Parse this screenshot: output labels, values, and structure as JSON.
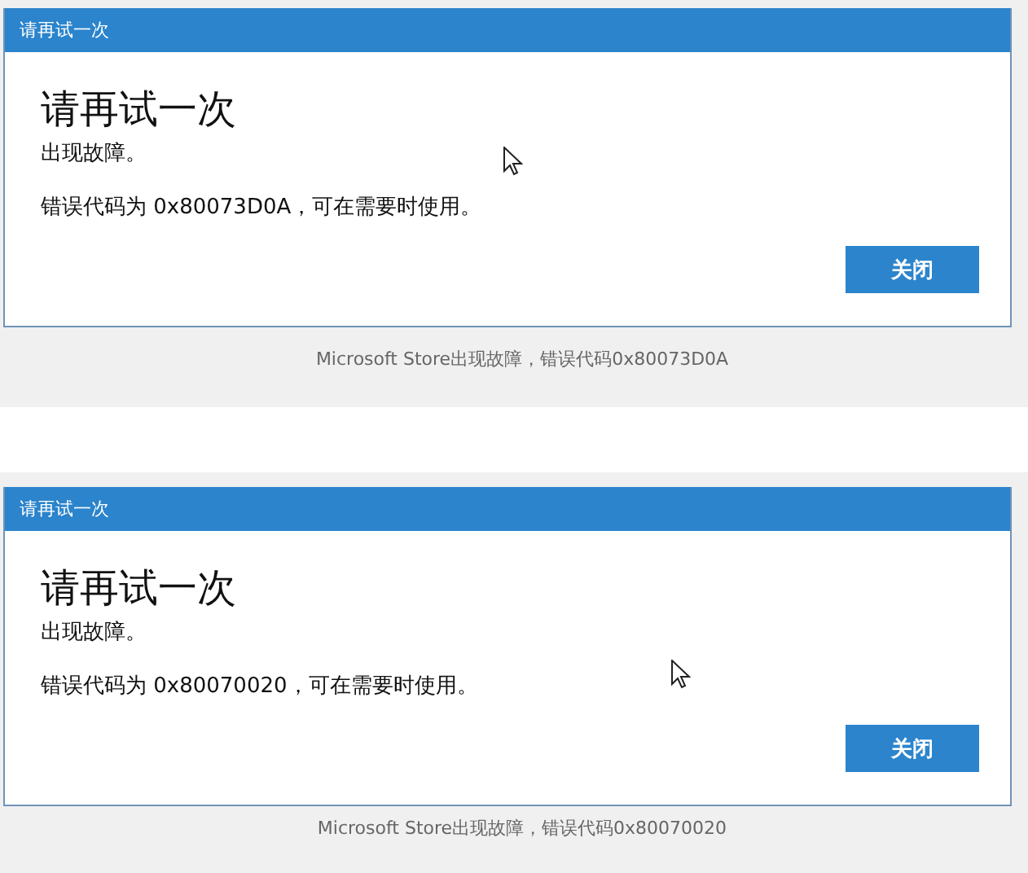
{
  "figures": [
    {
      "dialog": {
        "title": "请再试一次",
        "heading": "请再试一次",
        "message": "出现故障。",
        "detail": "错误代码为 0x80073D0A，可在需要时使用。",
        "button": "关闭"
      },
      "caption": "Microsoft Store出现故障，错误代码0x80073D0A"
    },
    {
      "dialog": {
        "title": "请再试一次",
        "heading": "请再试一次",
        "message": "出现故障。",
        "detail": "错误代码为 0x80070020，可在需要时使用。",
        "button": "关闭"
      },
      "caption": "Microsoft Store出现故障，错误代码0x80070020"
    }
  ]
}
